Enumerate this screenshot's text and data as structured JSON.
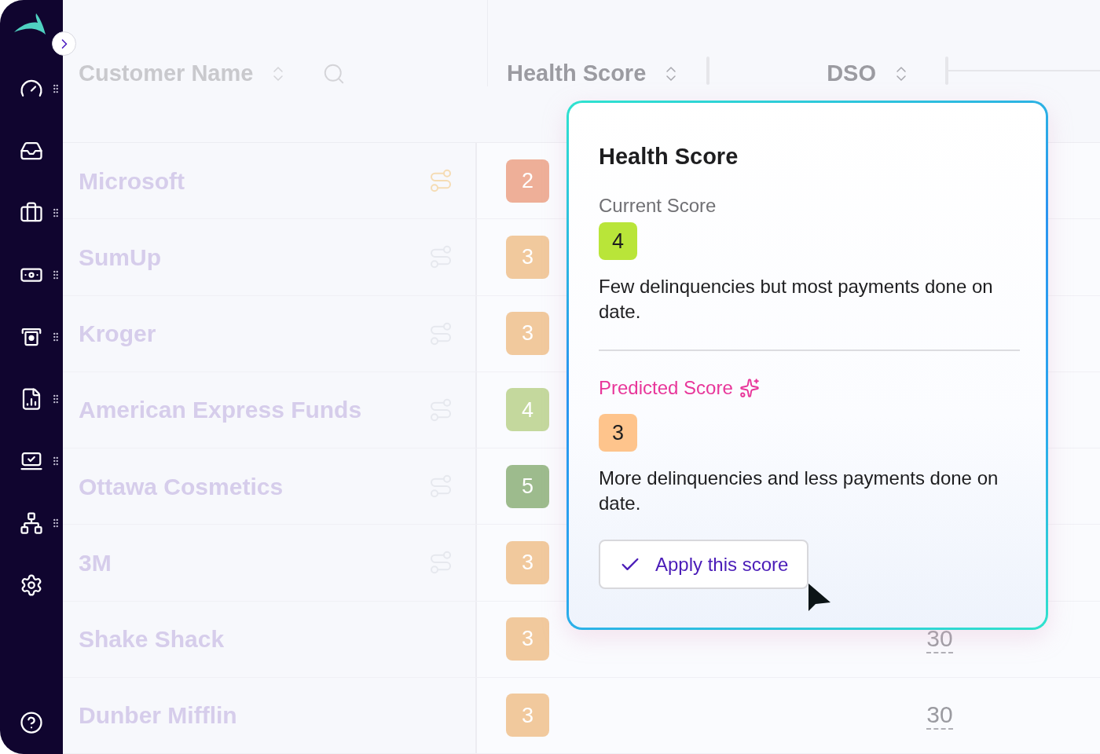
{
  "sidebar": {
    "items": [
      {
        "draggable": true
      },
      {
        "draggable": false
      },
      {
        "draggable": true
      },
      {
        "draggable": true
      },
      {
        "draggable": true
      },
      {
        "draggable": true
      },
      {
        "draggable": true
      },
      {
        "draggable": true
      },
      {
        "draggable": false
      }
    ]
  },
  "table": {
    "columns": [
      {
        "label": "Customer Name",
        "sortable": true,
        "searchable": true
      },
      {
        "label": "Health Score",
        "sortable": true,
        "searchable": false
      },
      {
        "label": "DSO",
        "sortable": true,
        "searchable": false
      }
    ],
    "rows": [
      {
        "name": "Microsoft",
        "linked": true,
        "highlighted": true,
        "score": "2",
        "color": "#eeaf98"
      },
      {
        "name": "SumUp",
        "linked": true,
        "highlighted": false,
        "score": "3",
        "color": "#f1c99d"
      },
      {
        "name": "Kroger",
        "linked": true,
        "highlighted": false,
        "score": "3",
        "color": "#f1c99d"
      },
      {
        "name": "American Express Funds",
        "linked": true,
        "highlighted": false,
        "score": "4",
        "color": "#c4d89d"
      },
      {
        "name": "Ottawa Cosmetics",
        "linked": true,
        "highlighted": false,
        "score": "5",
        "color": "#9dbb8d"
      },
      {
        "name": "3M",
        "linked": true,
        "highlighted": false,
        "score": "3",
        "color": "#f1c99d"
      },
      {
        "name": "Shake Shack",
        "linked": false,
        "score": "3",
        "color": "#f1c99d",
        "dso": "30"
      },
      {
        "name": "Dunber Mifflin",
        "linked": false,
        "score": "3",
        "color": "#f1c99d",
        "dso": "30"
      }
    ]
  },
  "popover": {
    "title": "Health Score",
    "current": {
      "label": "Current Score",
      "score": "4",
      "color": "#b9e539",
      "description": "Few delinquencies but most payments done on date."
    },
    "predicted": {
      "label": "Predicted Score",
      "score": "3",
      "color": "#fec48c",
      "description": "More delinquencies and less payments done on date."
    },
    "button": "Apply this score"
  }
}
